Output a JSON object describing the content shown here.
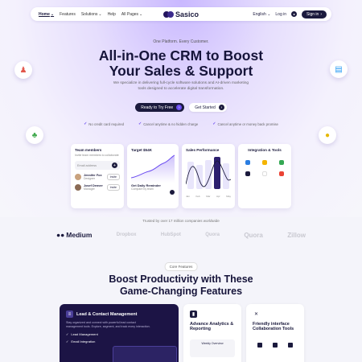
{
  "nav": {
    "links": [
      "Home",
      "Features",
      "Solutions",
      "Help",
      "All Pages"
    ],
    "brand": "Sasico",
    "language": "English",
    "login": "Log in",
    "signup": "Sign in"
  },
  "hero": {
    "eyebrow": "One Platform. Every Customer.",
    "title_line1": "All-in-One CRM to Boost",
    "title_line2": "Your Sales & Support",
    "subtitle": "We specialize in delivering full-cycle software solutions and AI-driven marketing tools designed to accelerate digital transformation.",
    "cta_primary": "Ready to Try Free",
    "cta_secondary": "Get Started",
    "checks": [
      "No credit card required",
      "Cancel anytime & no hidden charge",
      "Cancel anytime or money back promise"
    ]
  },
  "cards": {
    "team": {
      "title": "Team members",
      "subtitle": "Invite team members to collaborate",
      "email_placeholder": "Email address",
      "members": [
        {
          "name": "Jennifer Fox",
          "role": "Designer",
          "action": "Invite"
        },
        {
          "name": "Josef Denver",
          "role": "Manager",
          "action": "Invite"
        }
      ]
    },
    "target": {
      "title": "Target $54K",
      "value": "Get Daily Reminder",
      "sub": "Compare by team"
    },
    "sales": {
      "title": "Sales Performance",
      "months": [
        "Jan",
        "Feb",
        "Mar",
        "Apr",
        "May"
      ]
    },
    "integrations": {
      "title": "Integration & Tools"
    }
  },
  "trusted": "Trusted by over 17 million companies worldwide",
  "brands": [
    "Medium",
    "Dropbox",
    "HubSpot",
    "Quora",
    "Quora",
    "Zillow"
  ],
  "features": {
    "tag": "Core Features",
    "title_line1": "Boost Productivity with These",
    "title_line2": "Game-Changing Features",
    "lead": {
      "title": "Lead & Contact Management",
      "desc": "Stay organized and connect with powerful lead contact management tools. Explore, segment, and track every interaction.",
      "items": [
        "Lead Management",
        "Email Integration"
      ]
    },
    "analytics": {
      "title": "Advance Analytics & Reporting",
      "mock_label": "Weekly Overview"
    },
    "collab": {
      "title": "Friendly interface Collaboration Tools"
    }
  },
  "colors": {
    "accent": "#6c4ef0",
    "dark": "#1b1a3d",
    "feature_dark": "#1c1445"
  }
}
